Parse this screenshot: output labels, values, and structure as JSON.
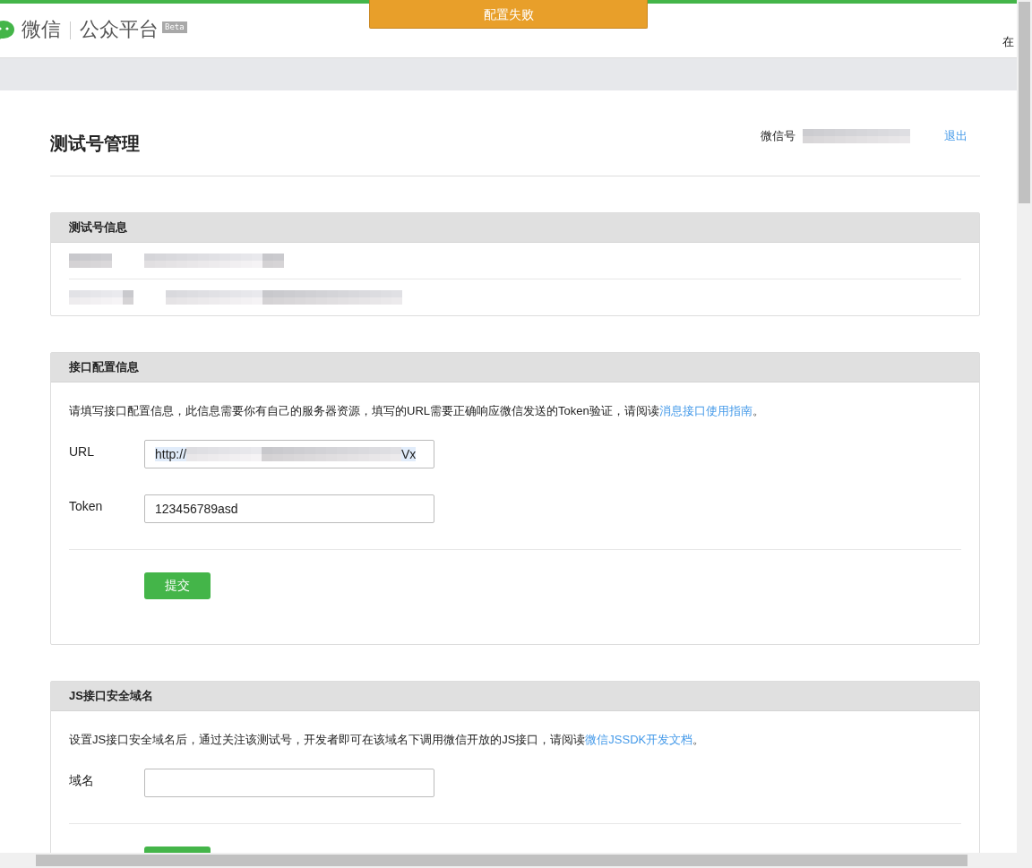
{
  "header": {
    "logo_text": "微信",
    "platform": "公众平台",
    "badge": "Beta",
    "right_text": "在"
  },
  "toast": {
    "message": "配置失败"
  },
  "page": {
    "title": "测试号管理",
    "account_label": "微信号",
    "logout": "退出"
  },
  "panels": [
    {
      "kind": "info",
      "title": "测试号信息"
    },
    {
      "kind": "form",
      "title": "接口配置信息",
      "intro": "请填写接口配置信息，此信息需要你有自己的服务器资源，填写的URL需要正确响应微信发送的Token验证，请阅读",
      "link": "消息接口使用指南",
      "intro_end": "。",
      "fields": [
        {
          "label": "URL",
          "value": "http://",
          "value_end": "Vx"
        },
        {
          "label": "Token",
          "value": "123456789asd"
        }
      ],
      "button": "提交"
    },
    {
      "kind": "form",
      "title": "JS接口安全域名",
      "intro": "设置JS接口安全域名后，通过关注该测试号，开发者即可在该域名下调用微信开放的JS接口，请阅读",
      "link": "微信JSSDK开发文档",
      "intro_end": "。",
      "fields": [
        {
          "label": "域名"
        }
      ]
    }
  ]
}
